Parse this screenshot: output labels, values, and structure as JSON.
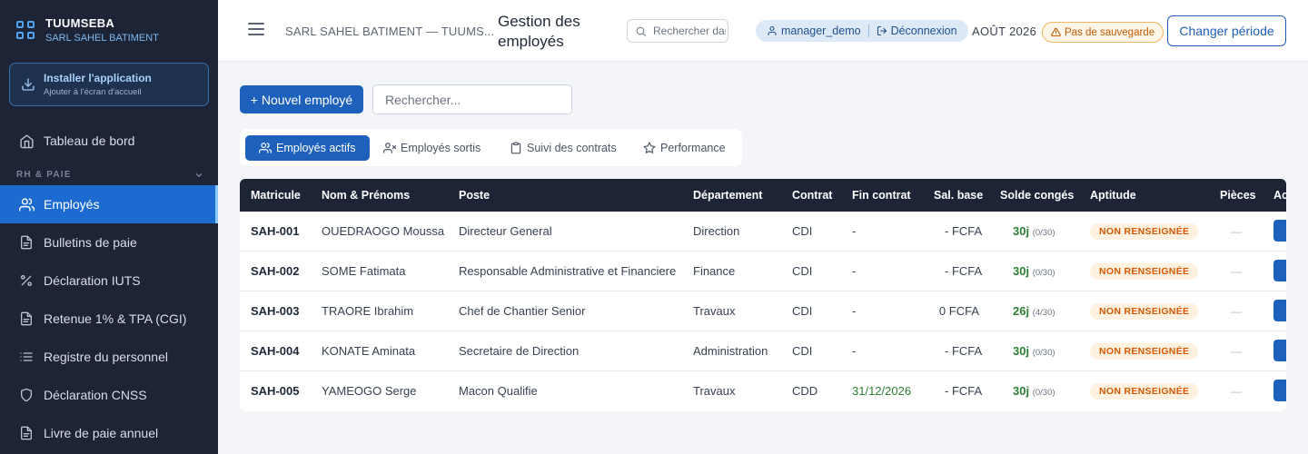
{
  "brand": {
    "name": "TUUMSEBA",
    "company": "SARL SAHEL BATIMENT"
  },
  "install": {
    "title": "Installer l'application",
    "subtitle": "Ajouter à l'écran d'accueil"
  },
  "sidebar": {
    "dashboard": "Tableau de bord",
    "section": "RH & PAIE",
    "items": [
      {
        "label": "Employés",
        "icon": "users-icon"
      },
      {
        "label": "Bulletins de paie",
        "icon": "file-icon"
      },
      {
        "label": "Déclaration IUTS",
        "icon": "percent-icon"
      },
      {
        "label": "Retenue 1% & TPA (CGI)",
        "icon": "file-icon"
      },
      {
        "label": "Registre du personnel",
        "icon": "list-icon"
      },
      {
        "label": "Déclaration CNSS",
        "icon": "shield-icon"
      },
      {
        "label": "Livre de paie annuel",
        "icon": "file-icon"
      }
    ]
  },
  "header": {
    "company": "SARL SAHEL BATIMENT — TUUMS...",
    "title": "Gestion des employés",
    "search_placeholder": "Rechercher dans",
    "user": "manager_demo",
    "logout": "Déconnexion",
    "period": "AOÛT 2026",
    "no_backup": "Pas de sauvegarde",
    "change_period": "Changer période"
  },
  "toolbar": {
    "new_employee": "+ Nouvel employé",
    "search_placeholder": "Rechercher..."
  },
  "tabs": [
    {
      "label": "Employés actifs",
      "icon": "users-icon"
    },
    {
      "label": "Employés sortis",
      "icon": "user-x-icon"
    },
    {
      "label": "Suivi des contrats",
      "icon": "clipboard-icon"
    },
    {
      "label": "Performance",
      "icon": "star-icon"
    }
  ],
  "table": {
    "headers": [
      "Matricule",
      "Nom & Prénoms",
      "Poste",
      "Département",
      "Contrat",
      "Fin contrat",
      "Sal. base",
      "Solde congés",
      "Aptitude",
      "Pièces",
      "Ac"
    ],
    "rows": [
      {
        "matricule": "SAH-001",
        "name": "OUEDRAOGO Moussa",
        "poste": "Directeur General",
        "departement": "Direction",
        "contrat": "CDI",
        "fin": "-",
        "salaire": "- FCFA",
        "conges": "30j",
        "conges_detail": "(0/30)",
        "aptitude": "NON RENSEIGNÉE",
        "pieces": "—"
      },
      {
        "matricule": "SAH-002",
        "name": "SOME Fatimata",
        "poste": "Responsable Administrative et Financiere",
        "departement": "Finance",
        "contrat": "CDI",
        "fin": "-",
        "salaire": "- FCFA",
        "conges": "30j",
        "conges_detail": "(0/30)",
        "aptitude": "NON RENSEIGNÉE",
        "pieces": "—"
      },
      {
        "matricule": "SAH-003",
        "name": "TRAORE Ibrahim",
        "poste": "Chef de Chantier Senior",
        "departement": "Travaux",
        "contrat": "CDI",
        "fin": "-",
        "salaire": "0 FCFA",
        "conges": "26j",
        "conges_detail": "(4/30)",
        "aptitude": "NON RENSEIGNÉE",
        "pieces": "—"
      },
      {
        "matricule": "SAH-004",
        "name": "KONATE Aminata",
        "poste": "Secretaire de Direction",
        "departement": "Administration",
        "contrat": "CDI",
        "fin": "-",
        "salaire": "- FCFA",
        "conges": "30j",
        "conges_detail": "(0/30)",
        "aptitude": "NON RENSEIGNÉE",
        "pieces": "—"
      },
      {
        "matricule": "SAH-005",
        "name": "YAMEOGO Serge",
        "poste": "Macon Qualifie",
        "departement": "Travaux",
        "contrat": "CDD",
        "fin": "31/12/2026",
        "salaire": "- FCFA",
        "conges": "30j",
        "conges_detail": "(0/30)",
        "aptitude": "NON RENSEIGNÉE",
        "pieces": "—"
      }
    ]
  },
  "colors": {
    "sidebar": "#1c2436",
    "accent": "#1d61bd",
    "active_nav": "#1d6bd0",
    "warning": "#d35a05",
    "success": "#2e7d32"
  }
}
